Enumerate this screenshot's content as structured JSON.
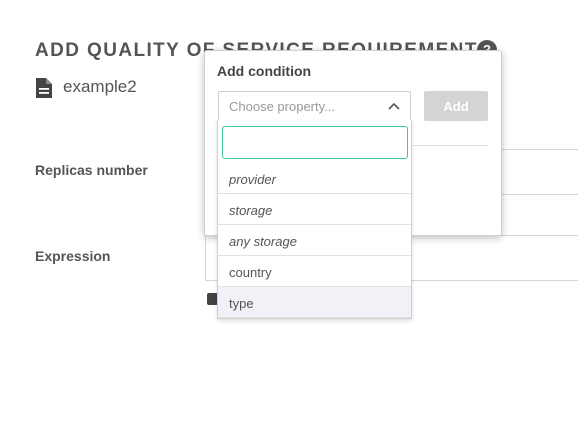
{
  "page": {
    "title": "ADD QUALITY OF SERVICE REQUIREMENT",
    "file_name": "example2",
    "help_icon": "?"
  },
  "form": {
    "replicas_label": "Replicas number",
    "expression_label": "Expression"
  },
  "popover": {
    "title": "Add condition",
    "select_placeholder": "Choose property...",
    "add_button": "Add",
    "search_value": "",
    "options": [
      {
        "label": "provider",
        "italic": true
      },
      {
        "label": "storage",
        "italic": true
      },
      {
        "label": "any storage",
        "italic": true
      },
      {
        "label": "country",
        "italic": false
      },
      {
        "label": "type",
        "italic": false,
        "highlighted": true
      }
    ]
  },
  "colors": {
    "focus_border": "#3ec6a0",
    "button_disabled": "#d4d4d4",
    "highlight_row": "#f1f1f7"
  }
}
